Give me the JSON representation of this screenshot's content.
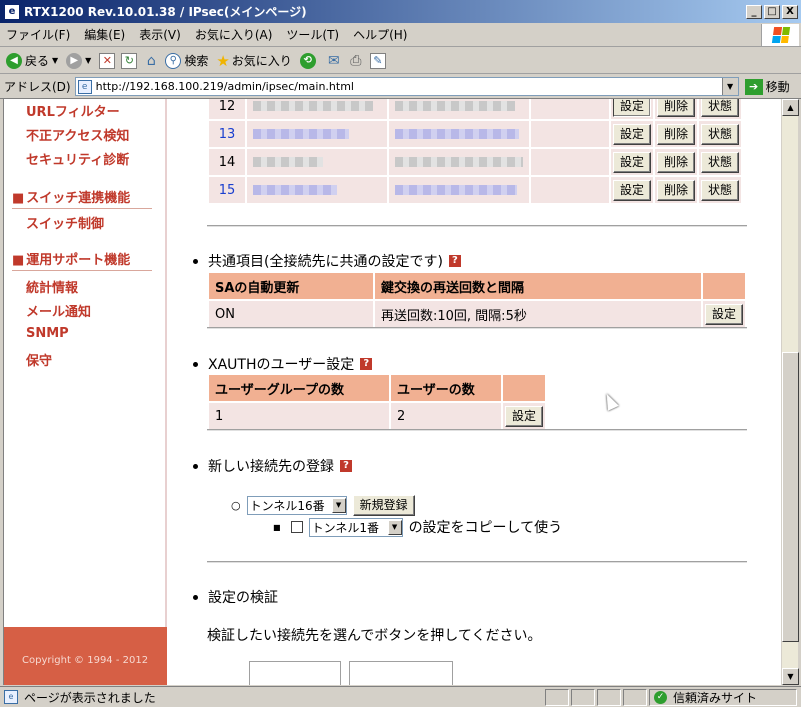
{
  "window": {
    "title": "RTX1200 Rev.10.01.38 / IPsec(メインページ)",
    "minimize": "_",
    "maximize": "□",
    "close": "X"
  },
  "menu": [
    "ファイル(F)",
    "編集(E)",
    "表示(V)",
    "お気に入り(A)",
    "ツール(T)",
    "ヘルプ(H)"
  ],
  "toolbar": {
    "back": "戻る",
    "search": "検索",
    "favorites": "お気に入り"
  },
  "address": {
    "label": "アドレス(D)",
    "url": "http://192.168.100.219/admin/ipsec/main.html",
    "go": "移動"
  },
  "sidebar": {
    "links_top": [
      "URLフィルター",
      "不正アクセス検知",
      "セキュリティ診断"
    ],
    "head_switch": "スイッチ連携機能",
    "links_switch": [
      "スイッチ制御"
    ],
    "head_support": "運用サポート機能",
    "links_support": [
      "統計情報",
      "メール通知",
      "SNMP",
      "保守"
    ],
    "copyright": "Copyright © 1994 - 2012"
  },
  "connections": {
    "rows": [
      {
        "num": "12",
        "link": false
      },
      {
        "num": "13",
        "link": true
      },
      {
        "num": "14",
        "link": false
      },
      {
        "num": "15",
        "link": true
      }
    ],
    "btn_settings": "設定",
    "btn_delete": "削除",
    "btn_status": "状態"
  },
  "common": {
    "title": "共通項目(全接続先に共通の設定です)",
    "help": "?",
    "col_sa": "SAの自動更新",
    "col_retry": "鍵交換の再送回数と間隔",
    "sa_value": "ON",
    "retry_value": "再送回数:10回, 間隔:5秒",
    "btn": "設定"
  },
  "xauth": {
    "title": "XAUTHのユーザー設定",
    "help": "?",
    "col_groups": "ユーザーグループの数",
    "col_users": "ユーザーの数",
    "groups_value": "1",
    "users_value": "2",
    "btn": "設定"
  },
  "new_conn": {
    "title": "新しい接続先の登録",
    "help": "?",
    "radio": "○",
    "tunnel_select": "トンネル16番",
    "register_btn": "新規登録",
    "copy_select": "トンネル1番",
    "copy_label": "の設定をコピーして使う"
  },
  "verify": {
    "title": "設定の検証",
    "desc": "検証したい接続先を選んでボタンを押してください。"
  },
  "status": {
    "text": "ページが表示されました",
    "zone": "信頼済みサイト"
  }
}
